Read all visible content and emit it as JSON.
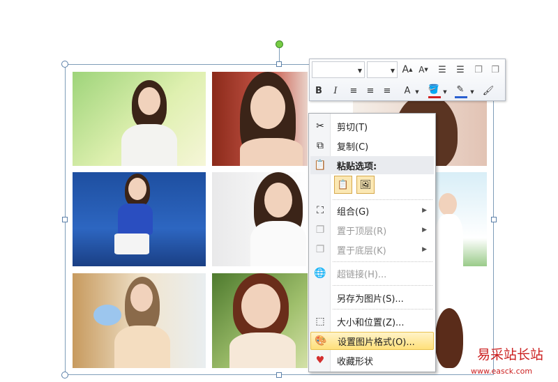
{
  "context_menu": {
    "cut": "剪切(T)",
    "copy": "复制(C)",
    "paste_options": "粘贴选项:",
    "group": "组合(G)",
    "bring_to_front": "置于顶层(R)",
    "send_to_back": "置于底层(K)",
    "hyperlink": "超链接(H)...",
    "save_as_picture": "另存为图片(S)...",
    "size_position": "大小和位置(Z)...",
    "format_picture": "设置图片格式(O)...",
    "favorite_shape": "收藏形状"
  },
  "mini_toolbar": {
    "bold": "B",
    "italic": "I",
    "font_color_letter": "A"
  },
  "watermark": {
    "title": "易采站长站",
    "url": "www.easck.com"
  },
  "colors": {
    "highlight": "#ffe07a",
    "rotation_handle": "#77cc44",
    "watermark": "#cc2020"
  }
}
